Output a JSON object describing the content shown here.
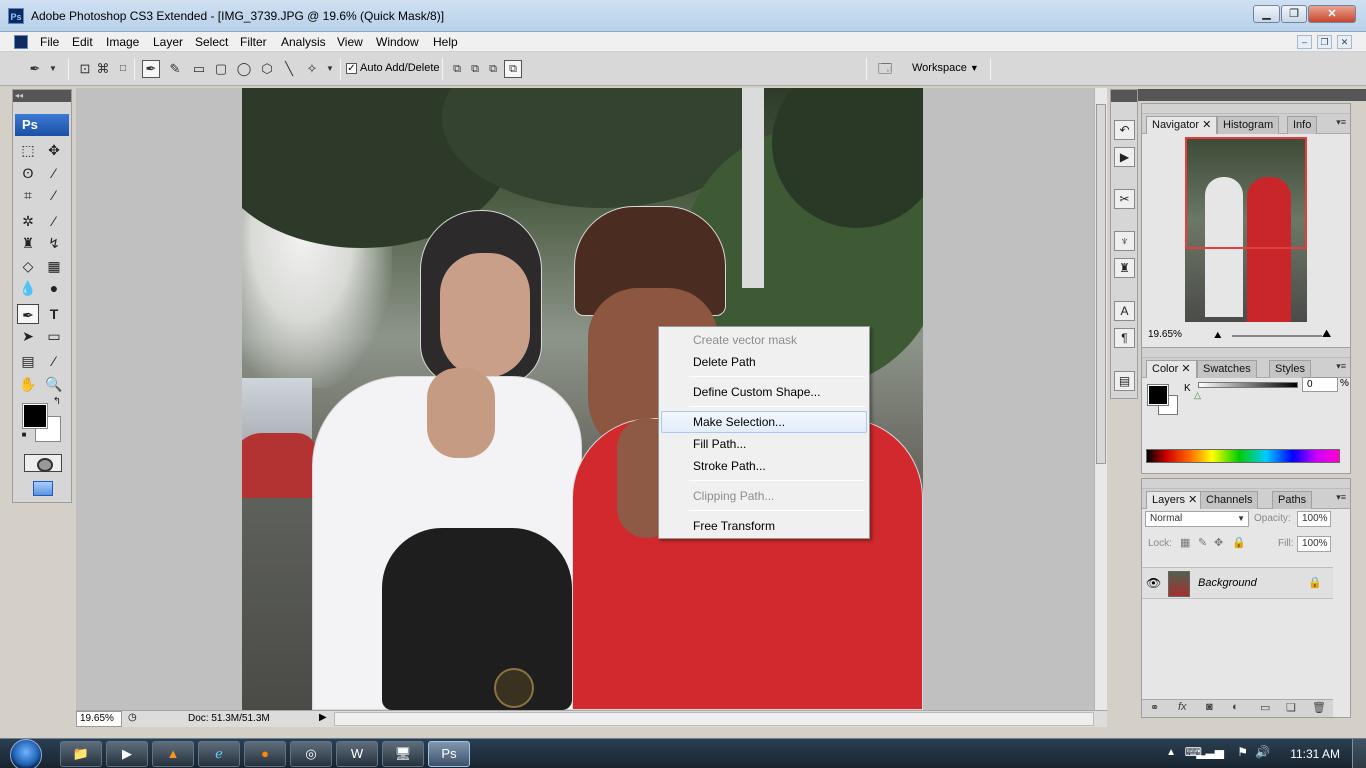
{
  "window": {
    "title": "Adobe Photoshop CS3 Extended - [IMG_3739.JPG @ 19.6% (Quick Mask/8)]",
    "app_icon": "Ps"
  },
  "menu": [
    "File",
    "Edit",
    "Image",
    "Layer",
    "Select",
    "Filter",
    "Analysis",
    "View",
    "Window",
    "Help"
  ],
  "options_bar": {
    "auto_add_delete_label": "Auto Add/Delete",
    "auto_add_delete_checked": true,
    "workspace_label": "Workspace"
  },
  "toolbox": {
    "badge": "Ps",
    "type_tool_glyph": "T"
  },
  "context_menu": {
    "items": [
      {
        "label": "Create vector mask",
        "disabled": true
      },
      {
        "label": "Delete Path",
        "disabled": false
      },
      {
        "label": "Define Custom Shape...",
        "disabled": false
      },
      {
        "label": "Make Selection...",
        "disabled": false,
        "highlighted": true
      },
      {
        "label": "Fill Path...",
        "disabled": false
      },
      {
        "label": "Stroke Path...",
        "disabled": false
      },
      {
        "label": "Clipping Path...",
        "disabled": true
      },
      {
        "label": "Free Transform",
        "disabled": false
      }
    ]
  },
  "status": {
    "zoom": "19.65%",
    "doc": "Doc: 51.3M/51.3M"
  },
  "navigator_panel": {
    "tabs": [
      "Navigator",
      "Histogram",
      "Info"
    ],
    "zoom": "19.65%"
  },
  "color_panel": {
    "tabs": [
      "Color",
      "Swatches",
      "Styles"
    ],
    "channel_label": "K",
    "value": "0",
    "unit": "%"
  },
  "layers_panel": {
    "tabs": [
      "Layers",
      "Channels",
      "Paths"
    ],
    "blend_mode": "Normal",
    "opacity_label": "Opacity:",
    "opacity": "100%",
    "lock_label": "Lock:",
    "fill_label": "Fill:",
    "fill": "100%",
    "layer_name": "Background"
  },
  "taskbar": {
    "clock": "11:31 AM"
  },
  "colors": {
    "highlight_border": "#a8c8ee",
    "foreground": "#000000",
    "background": "#ffffff",
    "nav_view_box": "#e53c3c"
  }
}
